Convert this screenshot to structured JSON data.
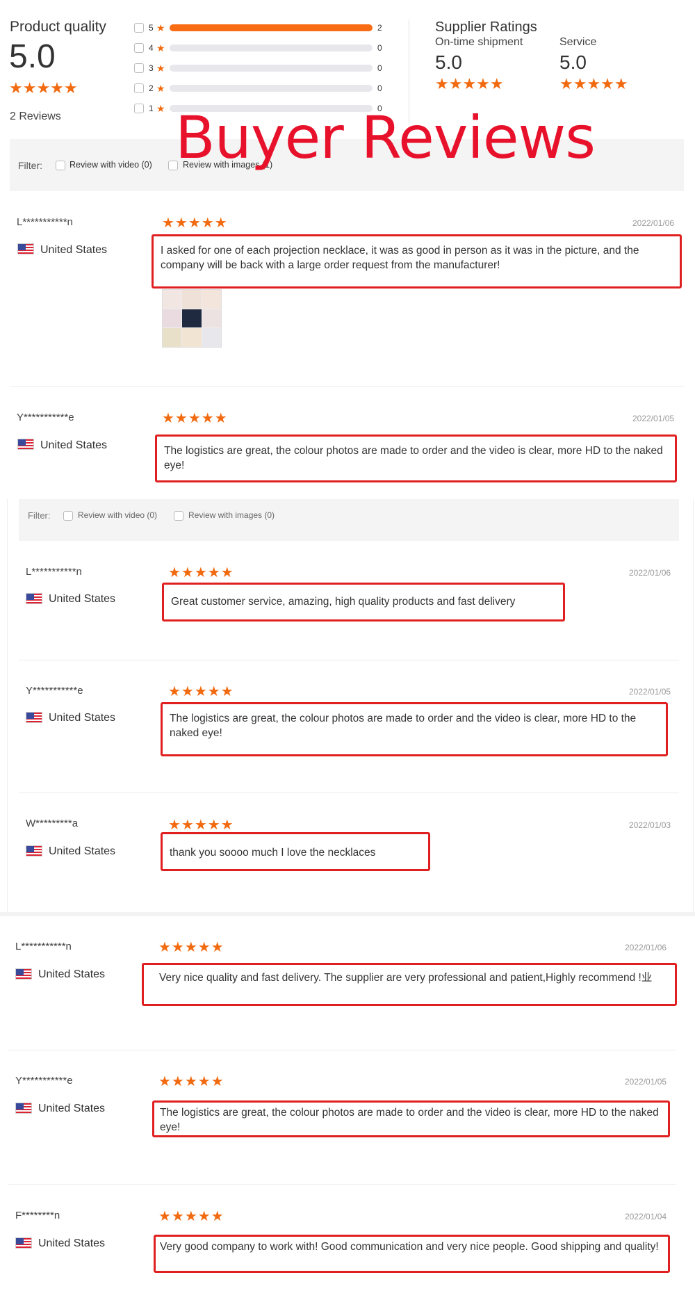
{
  "summary": {
    "product_quality_label": "Product quality",
    "product_quality_score": "5.0",
    "review_count_text": "2 Reviews",
    "stars": "★★★★★",
    "breakdown": [
      {
        "stars": "5",
        "count": "2",
        "fraction": 1.0
      },
      {
        "stars": "4",
        "count": "0",
        "fraction": 0
      },
      {
        "stars": "3",
        "count": "0",
        "fraction": 0
      },
      {
        "stars": "2",
        "count": "0",
        "fraction": 0
      },
      {
        "stars": "1",
        "count": "0",
        "fraction": 0
      }
    ],
    "supplier_ratings_label": "Supplier Ratings",
    "on_time_label": "On-time shipment",
    "on_time_score": "5.0",
    "service_label": "Service",
    "service_score": "5.0"
  },
  "overlay_title": "Buyer Reviews",
  "filters": [
    {
      "label": "Filter:",
      "video": "Review with video (0)",
      "images": "Review with images (1)"
    },
    {
      "label": "Filter:",
      "video": "Review with video (0)",
      "images": "Review with images (0)"
    }
  ],
  "reviews": [
    {
      "name": "L***********n",
      "country": "United States",
      "date": "2022/01/06",
      "text": "I asked for one of each projection necklace, it was as good in person as it was in the picture, and the company will be back with a large order request from the manufacturer!"
    },
    {
      "name": "Y***********e",
      "country": "United States",
      "date": "2022/01/05",
      "text": "The logistics are great, the colour photos are made to order and the video is clear, more HD to the naked eye!"
    },
    {
      "name": "L***********n",
      "country": "United States",
      "date": "2022/01/06",
      "text": "Great customer service, amazing, high quality products and fast delivery"
    },
    {
      "name": "Y***********e",
      "country": "United States",
      "date": "2022/01/05",
      "text": "The logistics are great, the colour photos are made to order and the video is clear, more HD to the naked eye!"
    },
    {
      "name": "W*********a",
      "country": "United States",
      "date": "2022/01/03",
      "text": "thank you soooo much I love the necklaces"
    },
    {
      "name": "L***********n",
      "country": "United States",
      "date": "2022/01/06",
      "text": "Very nice quality and fast delivery. The supplier are very professional and patient,Highly recommend !业"
    },
    {
      "name": "Y***********e",
      "country": "United States",
      "date": "2022/01/05",
      "text": "The logistics are great, the colour photos are made to order and the video is clear, more HD to the naked eye!"
    },
    {
      "name": "F********n",
      "country": "United States",
      "date": "2022/01/04",
      "text": "Very good company to work with! Good communication and very nice people. Good shipping and quality!"
    }
  ],
  "colors": {
    "accent": "#f86d14",
    "highlight": "#e02020",
    "title": "#e8112b"
  }
}
